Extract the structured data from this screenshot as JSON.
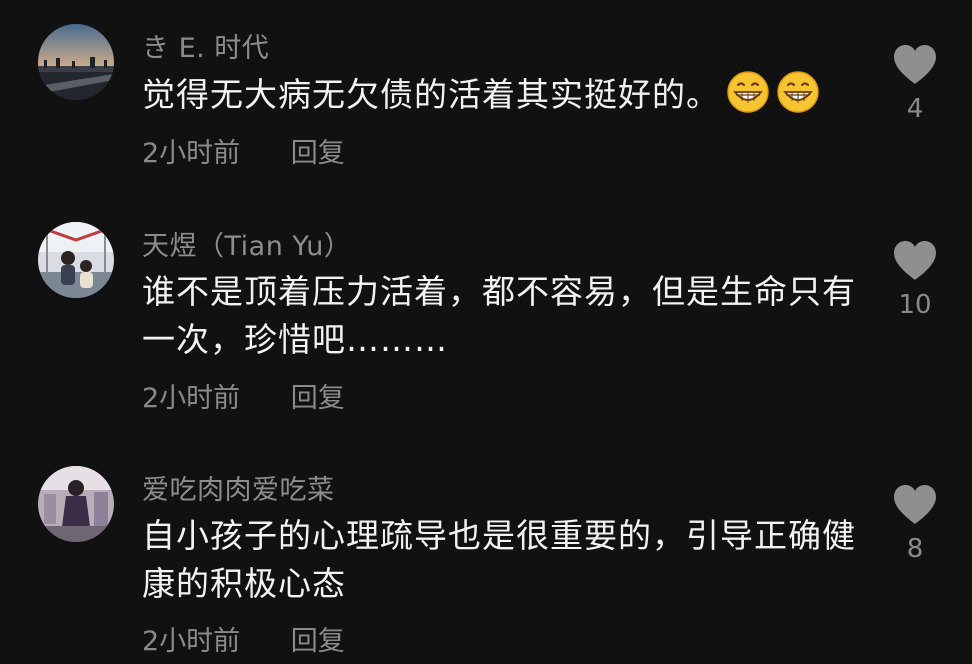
{
  "comments": [
    {
      "username": "き E. 时代",
      "text": "觉得无大病无欠债的活着其实挺好的。",
      "emoji_count": 2,
      "time": "2小时前",
      "reply_label": "回复",
      "likes": "4"
    },
    {
      "username": "天煜（Tian Yu）",
      "text": "谁不是顶着压力活着，都不容易，但是生命只有一次，珍惜吧………",
      "time": "2小时前",
      "reply_label": "回复",
      "likes": "10"
    },
    {
      "username": "爱吃肉肉爱吃菜",
      "text": "自小孩子的心理疏导也是很重要的，引导正确健康的积极心态",
      "time": "2小时前",
      "reply_label": "回复",
      "likes": "8"
    }
  ],
  "colors": {
    "background": "#111111",
    "username": "#8d8d8d",
    "body_text": "#f2f2f2",
    "meta": "#8a8a8a",
    "heart": "#8f8f8f"
  },
  "icons": {
    "like": "heart-icon",
    "emoji": "grinning-face-icon"
  }
}
